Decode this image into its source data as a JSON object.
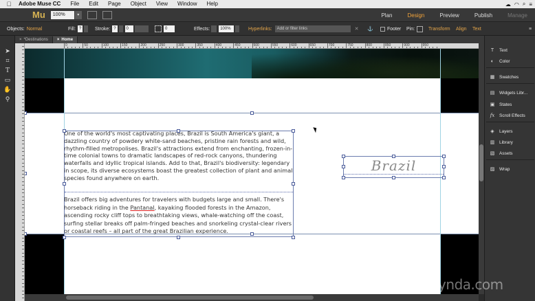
{
  "menubar": {
    "app_name": "Adobe Muse CC",
    "items": [
      "File",
      "Edit",
      "Page",
      "Object",
      "View",
      "Window",
      "Help"
    ]
  },
  "appbar": {
    "logo": "Mu",
    "zoom": "100%",
    "modes": [
      "Plan",
      "Design",
      "Preview",
      "Publish",
      "Manage"
    ],
    "active_mode": "Design"
  },
  "controlbar": {
    "objects_label": "Objects:",
    "objects_value": "Normal",
    "fill_label": "Fill:",
    "stroke_label": "Stroke:",
    "stroke_width": "0",
    "corner_value": "0",
    "effects_label": "Effects:",
    "opacity": "100%",
    "hyperlinks_label": "Hyperlinks:",
    "hyperlinks_placeholder": "Add or filter links",
    "footer_label": "Footer",
    "pin_label": "Pin:",
    "transform": "Transform",
    "align": "Align",
    "text": "Text"
  },
  "tabs": [
    {
      "label": "*Destinations",
      "active": false
    },
    {
      "label": "Home",
      "active": true
    }
  ],
  "ruler": {
    "marks": [
      "0",
      "50",
      "100",
      "150",
      "200",
      "250",
      "300",
      "350",
      "400",
      "450",
      "500",
      "550",
      "600",
      "650",
      "700",
      "750",
      "800",
      "850",
      "900",
      "950"
    ]
  },
  "canvas": {
    "para1": "One of the world's most captivating places, Brazil is South America's giant, a dazzling country of powdery white-sand beaches, pristine rain forests and wild, rhythm-filled metropolises. Brazil's attractions extend from enchanting, frozen-in-time colonial towns to dramatic landscapes of red-rock canyons, thundering waterfalls and idyllic tropical islands. Add to that, Brazil's biodiversity: legendary in scope, its diverse ecosystems boast the greatest collection of plant and animal species found anywhere on earth.",
    "para2_before": "Brazil offers big adventures for travelers with budgets large and small. There's horseback riding in the ",
    "para2_link": "Pantanal",
    "para2_after": ", kayaking flooded forests in the Amazon, ascending rocky cliff tops to breathtaking views, whale-watching off the coast, surfing stellar breaks off palm-fringed beaches and snorkeling crystal-clear rivers or coastal reefs – all part of the great Brazilian experience.",
    "heading": "Brazil"
  },
  "panel": {
    "items": [
      {
        "label": "Text",
        "icon": "text-icon"
      },
      {
        "label": "Color",
        "icon": "color-icon"
      },
      {
        "label": "Swatches",
        "icon": "swatches-icon"
      },
      {
        "label": "Widgets Libr...",
        "icon": "widgets-icon"
      },
      {
        "label": "States",
        "icon": "states-icon"
      },
      {
        "label": "Scroll Effects",
        "icon": "scroll-effects-icon"
      },
      {
        "label": "Layers",
        "icon": "layers-icon"
      },
      {
        "label": "Library",
        "icon": "library-icon"
      },
      {
        "label": "Assets",
        "icon": "assets-icon"
      },
      {
        "label": "Wrap",
        "icon": "wrap-icon"
      }
    ]
  },
  "watermark": "lynda.com",
  "colors": {
    "accent": "#f2a33a",
    "selection": "#4a5b9a",
    "guide": "#9fd3e3"
  }
}
